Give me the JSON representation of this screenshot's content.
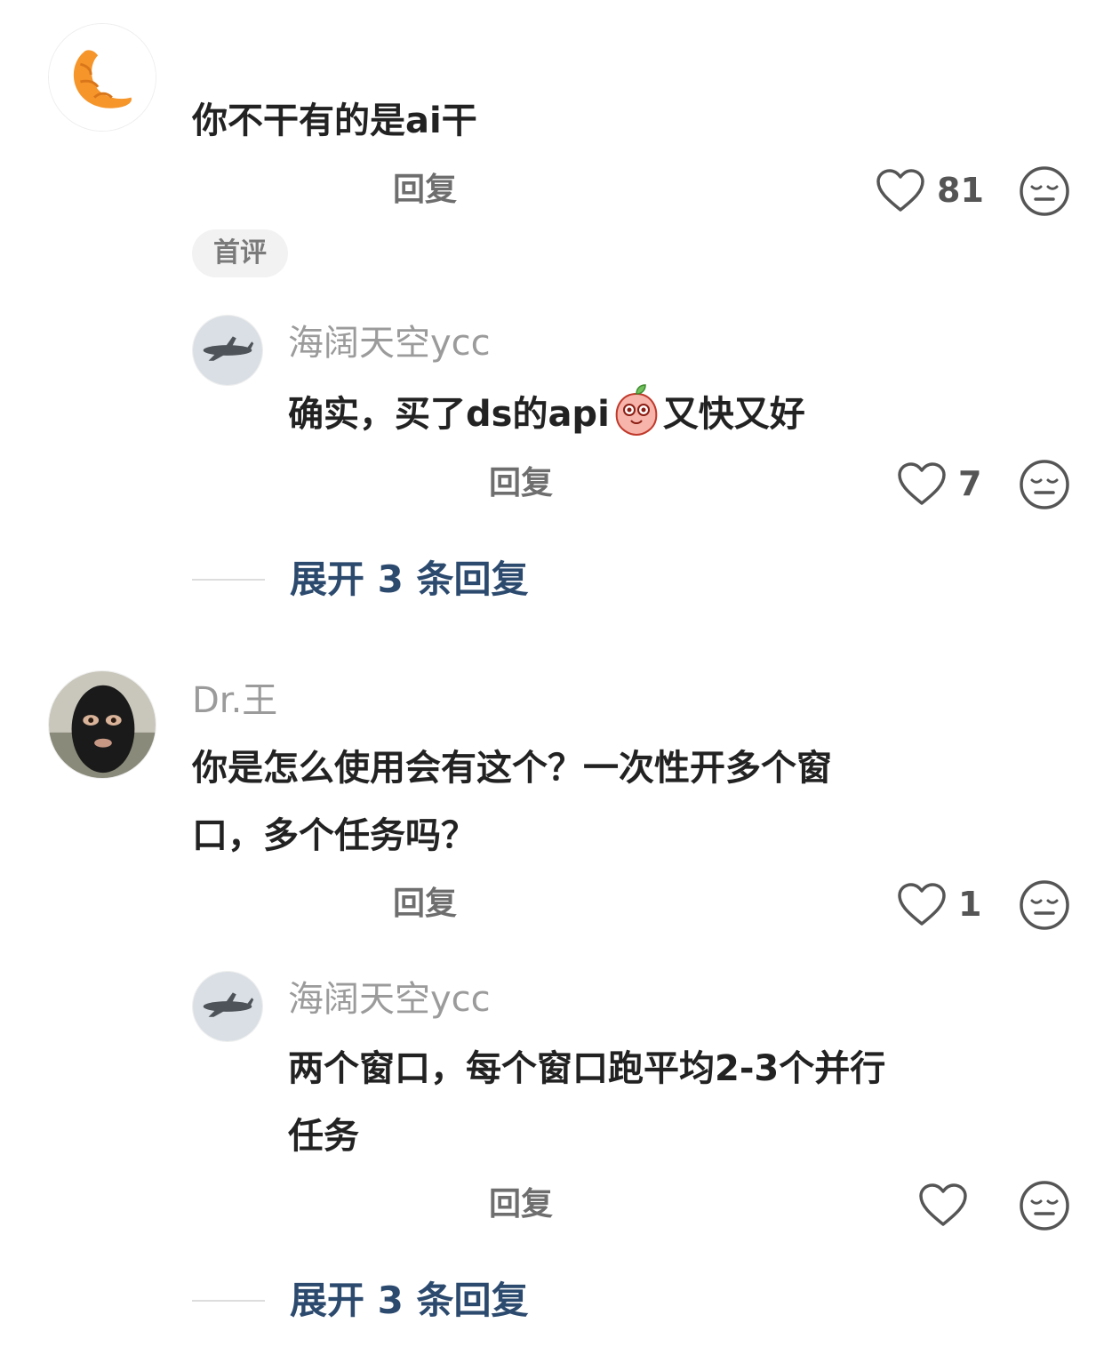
{
  "comments": [
    {
      "username": "",
      "content_lines": [
        "你不干有的是ai干"
      ],
      "reply_label": "回复",
      "like_count": "81",
      "badge": "首评",
      "avatar": "croissant-avatar",
      "replies": [
        {
          "username": "海阔天空ycc",
          "content_before_emoji": "确实，买了ds的api",
          "emoji": "peach-emoji",
          "content_after_emoji": "又快又好",
          "reply_label": "回复",
          "like_count": "7",
          "avatar": "airplane-avatar"
        }
      ],
      "expand_label": "展开 3 条回复"
    },
    {
      "username": "Dr.王",
      "content_lines": [
        "你是怎么使用会有这个？一次性开多个窗",
        "口，多个任务吗？"
      ],
      "reply_label": "回复",
      "like_count": "1",
      "avatar": "masked-person-avatar",
      "replies": [
        {
          "username": "海阔天空ycc",
          "content_lines": [
            "两个窗口，每个窗口跑平均2-3个并行",
            "任务"
          ],
          "reply_label": "回复",
          "like_count": "",
          "avatar": "airplane-avatar"
        }
      ],
      "expand_label": "展开 3 条回复"
    }
  ],
  "icons": {
    "like": "heart-outline-icon",
    "dislike": "neutral-face-icon"
  },
  "colors": {
    "username": "#9b9b9b",
    "expand_link": "#2c4a6e",
    "badge_bg": "#f2f2f2"
  }
}
